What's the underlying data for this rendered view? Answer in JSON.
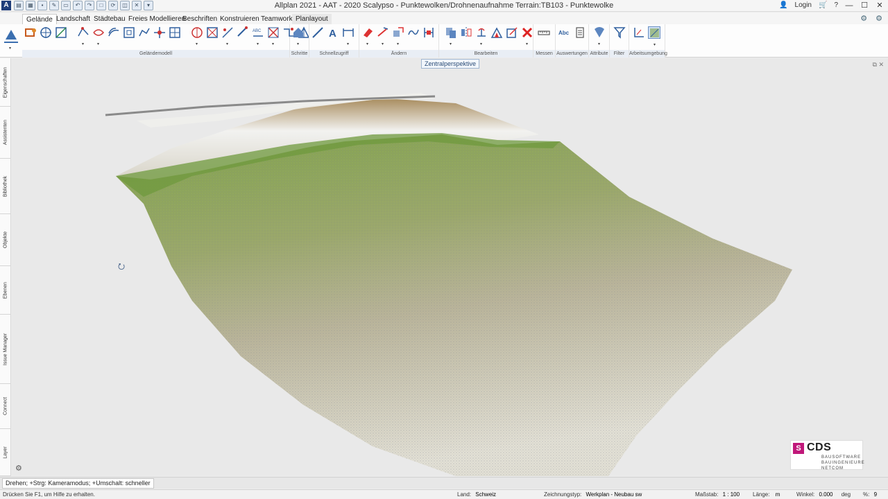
{
  "window": {
    "app_logo": "A",
    "title": "Allplan 2021 - AAT - 2020 Scalypso - Punktewolken/Drohnenaufnahme Terrain:TB103 - Punktewolke",
    "login_label": "Login",
    "minimize_icon": "minimize-icon",
    "maximize_icon": "maximize-icon",
    "close_icon": "close-icon"
  },
  "tabs": [
    {
      "label": "Gelände",
      "active": true
    },
    {
      "label": "Landschaft"
    },
    {
      "label": "Städtebau"
    },
    {
      "label": "Freies Modellieren"
    },
    {
      "label": "Beschriften"
    },
    {
      "label": "Konstruieren"
    },
    {
      "label": "Teamwork"
    },
    {
      "label": "Planlayout"
    }
  ],
  "ribbon_groups": [
    {
      "label": "Geländemodell"
    },
    {
      "label": "Schritte"
    },
    {
      "label": "Schnellzugriff"
    },
    {
      "label": "Ändern"
    },
    {
      "label": "Bearbeiten"
    },
    {
      "label": "Messen"
    },
    {
      "label": "Auswertungen"
    },
    {
      "label": "Attribute"
    },
    {
      "label": "Filter"
    },
    {
      "label": "Arbeitsumgebung"
    }
  ],
  "side_tabs": [
    {
      "label": "Eigenschaften"
    },
    {
      "label": "Assistenten"
    },
    {
      "label": "Bibliothek"
    },
    {
      "label": "Objekte"
    },
    {
      "label": "Ebenen"
    },
    {
      "label": "Issue Manager"
    },
    {
      "label": "Connect"
    },
    {
      "label": "Layer"
    }
  ],
  "viewport": {
    "view_label": "Zentralperspektive",
    "corner_icons": "⧉ ✕"
  },
  "logo": {
    "mark": "S",
    "name": "CDS",
    "sub1": "BAUSOFTWARE",
    "sub2": "BAUINGENIEURE",
    "sub3": "NETCOM"
  },
  "hint": "Drehen; +Strg: Kameramodus; +Umschalt: schneller",
  "status": {
    "help": "Drücken Sie F1, um Hilfe zu erhalten.",
    "land_label": "Land:",
    "land_value": "Schweiz",
    "zeichnungstyp_label": "Zeichnungstyp:",
    "zeichnungstyp_value": "Werkplan - Neubau sw",
    "massstab_label": "Maßstab:",
    "massstab_value": "1 : 100",
    "laenge_label": "Länge:",
    "laenge_value": "m",
    "winkel_label": "Winkel:",
    "winkel_value": "0.000",
    "winkel_unit": "deg",
    "percent_label": "%:",
    "percent_value": "9"
  },
  "colors": {
    "accent": "#1f3d7a",
    "logo_magenta": "#c0187a",
    "grass": "#7fa34a",
    "soil": "#a88c5e",
    "rock": "#f2f2f0"
  }
}
